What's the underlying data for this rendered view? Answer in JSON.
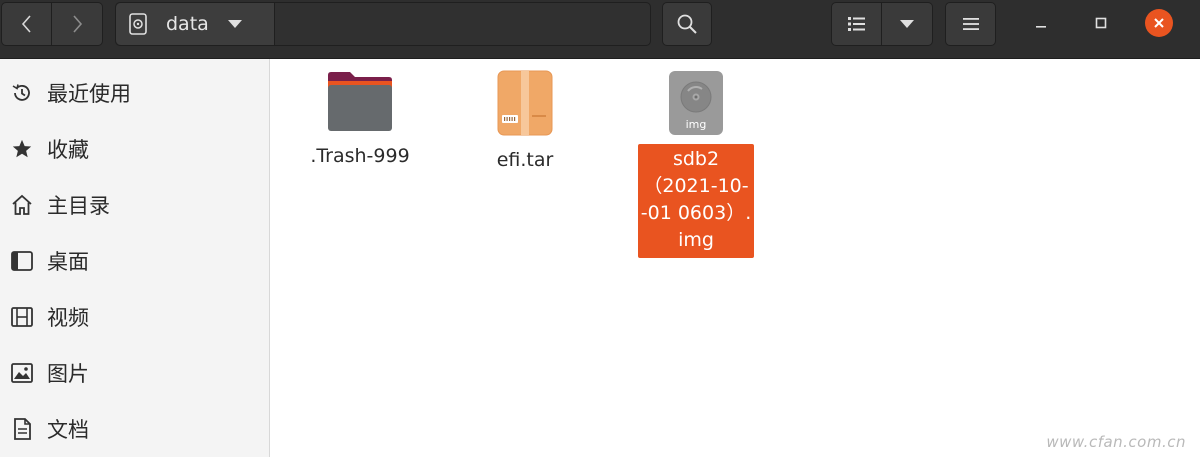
{
  "header": {
    "path": {
      "segment_label": "data"
    }
  },
  "sidebar": {
    "items": [
      {
        "label": "最近使用",
        "icon": "recent-icon"
      },
      {
        "label": "收藏",
        "icon": "star-icon"
      },
      {
        "label": "主目录",
        "icon": "home-icon"
      },
      {
        "label": "桌面",
        "icon": "desktop-icon"
      },
      {
        "label": "视频",
        "icon": "video-icon"
      },
      {
        "label": "图片",
        "icon": "picture-icon"
      },
      {
        "label": "文档",
        "icon": "document-icon"
      }
    ]
  },
  "files": {
    "trash": {
      "name": ".Trash-999",
      "icon": "folder-icon"
    },
    "efi": {
      "name": "efi.tar",
      "icon": "archive-icon"
    },
    "img": {
      "icon": "disk-image-icon",
      "icon_label": "img",
      "name_lines": [
        "sdb2",
        "（2021-10-",
        "-01 0603）.",
        "img"
      ],
      "selected": true
    }
  },
  "watermark": "www.cfan.com.cn",
  "colors": {
    "header_bg": "#2e2e2e",
    "accent": "#e95420",
    "sidebar_bg": "#f4f4f4"
  }
}
